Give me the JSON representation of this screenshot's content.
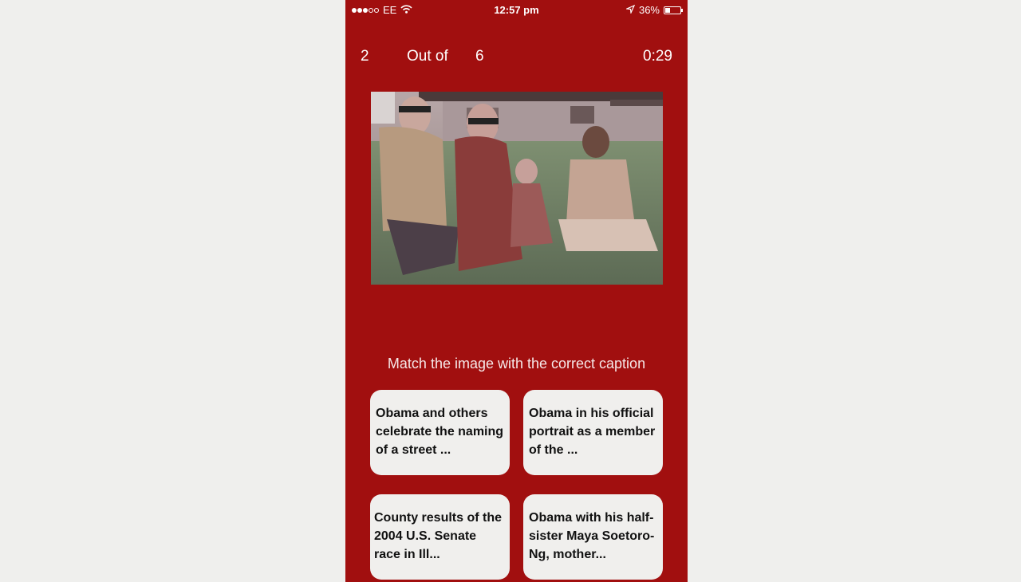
{
  "status_bar": {
    "carrier": "EE",
    "time": "12:57 pm",
    "battery": "36%",
    "battery_level": 0.36,
    "signal_bars_filled": 3,
    "signal_bars_total": 5
  },
  "quiz": {
    "current": "2",
    "out_of_label": "Out of",
    "total": "6",
    "timer": "0:29"
  },
  "instruction": "Match the image with the correct caption",
  "choices": [
    {
      "text": "Obama and others celebrate the naming of a street ..."
    },
    {
      "text": "Obama in his official portrait as a member of the ..."
    },
    {
      "text": "County results of the 2004 U.S. Senate race in Ill..."
    },
    {
      "text": "Obama with his half-sister Maya Soetoro-Ng, mother..."
    }
  ],
  "colors": {
    "background": "#a10f0f",
    "page": "#efefed",
    "card": "#f0efed"
  }
}
